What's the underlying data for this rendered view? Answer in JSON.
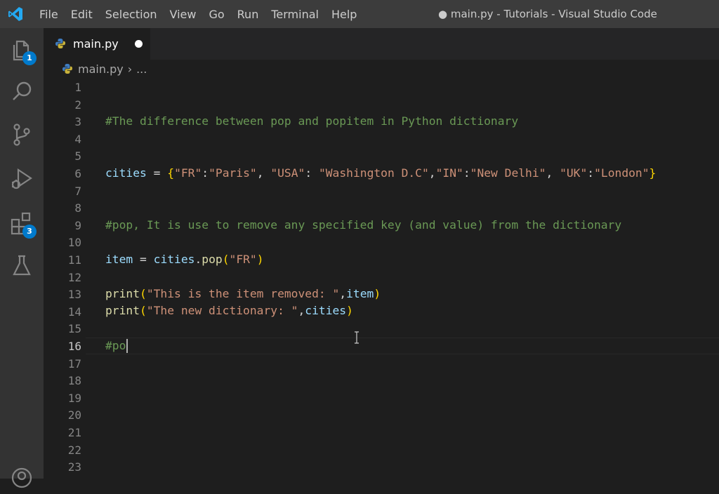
{
  "window": {
    "title": "● main.py - Tutorials - Visual Studio Code"
  },
  "menu": [
    "File",
    "Edit",
    "Selection",
    "View",
    "Go",
    "Run",
    "Terminal",
    "Help"
  ],
  "activity_bar": {
    "items": [
      {
        "name": "explorer",
        "icon": "files-icon",
        "badge": "1"
      },
      {
        "name": "search",
        "icon": "search-icon"
      },
      {
        "name": "source-control",
        "icon": "source-control-icon"
      },
      {
        "name": "run-debug",
        "icon": "run-debug-icon"
      },
      {
        "name": "extensions",
        "icon": "extensions-icon",
        "badge": "3"
      },
      {
        "name": "testing",
        "icon": "flask-icon"
      },
      {
        "name": "accounts",
        "icon": "account-icon"
      }
    ]
  },
  "tab": {
    "label": "main.py",
    "dirty": true,
    "icon": "python-icon"
  },
  "breadcrumb": {
    "file": "main.py",
    "rest": "..."
  },
  "editor": {
    "active_line": 16,
    "line_numbers": [
      "1",
      "2",
      "3",
      "4",
      "5",
      "6",
      "7",
      "8",
      "9",
      "10",
      "11",
      "12",
      "13",
      "14",
      "15",
      "16",
      "17",
      "18",
      "19",
      "20",
      "21",
      "22",
      "23"
    ],
    "lines": {
      "l3": {
        "comment": "#The difference between pop and popitem in Python dictionary"
      },
      "l6": {
        "var": "cities",
        "op": " = ",
        "open": "{",
        "k1": "\"FR\"",
        "c1": ":",
        "v1": "\"Paris\"",
        "s1": ", ",
        "k2": "\"USA\"",
        "c2": ": ",
        "v2": "\"Washington D.C\"",
        "s2": ",",
        "k3": "\"IN\"",
        "c3": ":",
        "v3": "\"New Delhi\"",
        "s3": ", ",
        "k4": "\"UK\"",
        "c4": ":",
        "v4": "\"London\"",
        "close": "}"
      },
      "l9": {
        "comment": "#pop, It is use to remove any specified key (and value) from the dictionary"
      },
      "l11": {
        "var": "item",
        "op": " = ",
        "obj": "cities",
        "dot": ".",
        "fn": "pop",
        "open": "(",
        "arg": "\"FR\"",
        "close": ")"
      },
      "l13": {
        "fn": "print",
        "open": "(",
        "str": "\"This is the item removed: \"",
        "comma": ",",
        "arg": "item",
        "close": ")"
      },
      "l14": {
        "fn": "print",
        "open": "(",
        "str": "\"The new dictionary: \"",
        "comma": ",",
        "arg": "cities",
        "close": ")"
      },
      "l16": {
        "comment": "#po"
      }
    }
  },
  "colors": {
    "background": "#1e1e1e",
    "comment": "#6a9955",
    "variable": "#9cdcfe",
    "function": "#dcdcaa",
    "string": "#ce9178",
    "accent": "#007acc"
  }
}
